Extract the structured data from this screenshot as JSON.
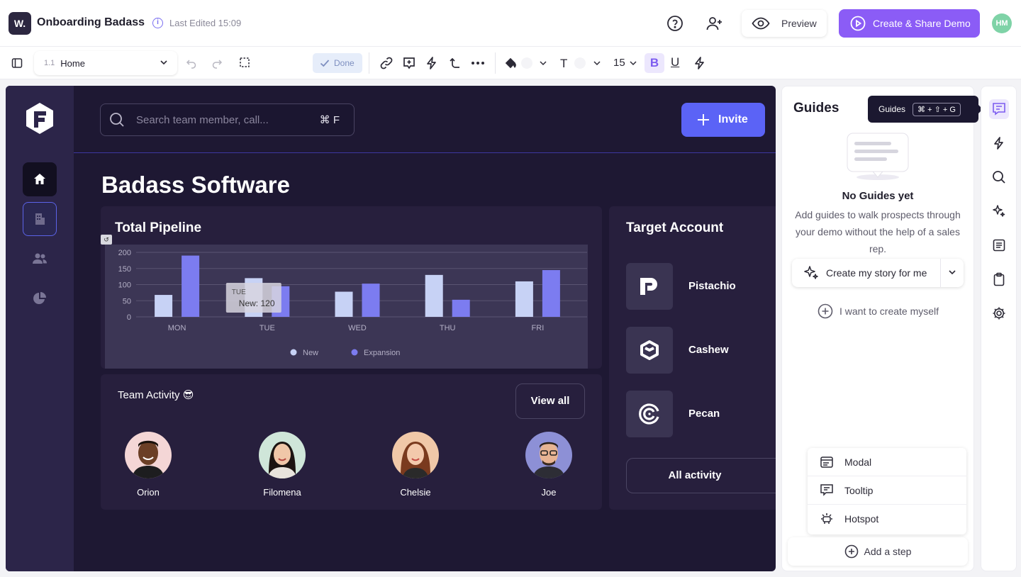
{
  "header": {
    "logo_text": "W.",
    "doc_title": "Onboarding Badass",
    "info_glyph": "i",
    "last_edited": "Last Edited 15:09",
    "preview_label": "Preview",
    "share_label": "Create & Share Demo",
    "user_initials": "HM",
    "accent": "#8b5cf6"
  },
  "toolbar": {
    "page_number": "1.1",
    "page_name": "Home",
    "done_label": "Done",
    "font_size": "15",
    "bold_label": "B",
    "underline_label": "U",
    "text_label": "T"
  },
  "app": {
    "search_placeholder": "Search team member, call...",
    "search_shortcut": "⌘ F",
    "invite_label": "Invite",
    "page_title": "Badass Software",
    "pipeline_title": "Total Pipeline",
    "activity_title": "Team Activity 😎",
    "view_all_label": "View all",
    "target_title": "Target Account",
    "all_activity_label": "All activity",
    "team": [
      {
        "name": "Orion"
      },
      {
        "name": "Filomena"
      },
      {
        "name": "Chelsie"
      },
      {
        "name": "Joe"
      }
    ],
    "accounts": [
      {
        "name": "Pistachio",
        "icon": "pistachio-logo-icon"
      },
      {
        "name": "Cashew",
        "icon": "cashew-logo-icon"
      },
      {
        "name": "Pecan",
        "icon": "pecan-logo-icon"
      }
    ]
  },
  "chart_data": {
    "type": "bar",
    "title": "Total Pipeline",
    "categories": [
      "MON",
      "TUE",
      "WED",
      "THU",
      "FRI"
    ],
    "series": [
      {
        "name": "New",
        "values": [
          68,
          120,
          78,
          130,
          110
        ],
        "color": "#c7d2f5"
      },
      {
        "name": "Expansion",
        "values": [
          190,
          95,
          103,
          53,
          145
        ],
        "color": "#7c7cf0"
      }
    ],
    "yticks": [
      0,
      50,
      100,
      150,
      200
    ],
    "ylim": [
      0,
      200
    ],
    "grid": true,
    "legend": "bottom",
    "tooltip": {
      "day": "TUE",
      "text": "New: 120"
    }
  },
  "guides": {
    "title": "Guides",
    "tooltip_label": "Guides",
    "tooltip_shortcut": "⌘ + ⇧ + G",
    "empty_title": "No Guides yet",
    "empty_desc": "Add guides to walk prospects through your demo without the help of a sales rep.",
    "story_label": "Create my story for me",
    "create_self_label": "I want to create myself",
    "step_types": [
      {
        "label": "Modal",
        "icon": "modal-icon"
      },
      {
        "label": "Tooltip",
        "icon": "tooltip-icon"
      },
      {
        "label": "Hotspot",
        "icon": "hotspot-icon"
      }
    ],
    "add_step_label": "Add a step"
  }
}
